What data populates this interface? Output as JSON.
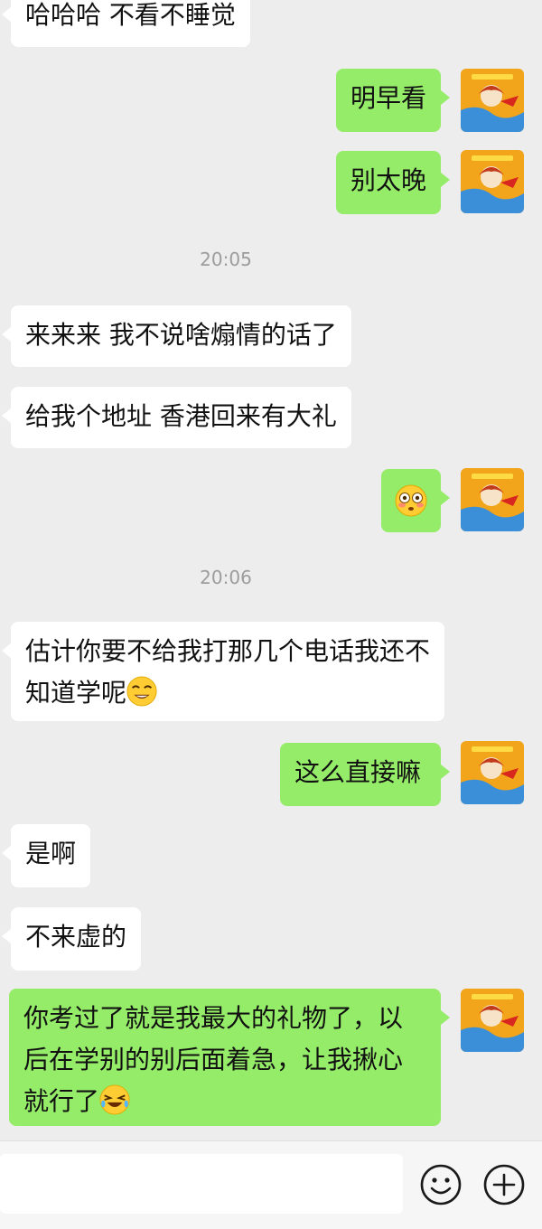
{
  "messages": [
    {
      "side": "in",
      "text": "哈哈哈 不看不睡觉"
    },
    {
      "side": "out",
      "text": "明早看"
    },
    {
      "side": "out",
      "text": "别太晚"
    },
    {
      "type": "time",
      "text": "20:05"
    },
    {
      "side": "in",
      "text": "来来来 我不说啥煽情的话了"
    },
    {
      "side": "in",
      "text": "给我个地址 香港回来有大礼"
    },
    {
      "side": "out",
      "emoji": "flushed-face-emoji"
    },
    {
      "type": "time",
      "text": "20:06"
    },
    {
      "side": "in",
      "text": "估计你要不给我打那几个电话我还不知道学呢"
    },
    {
      "side": "out",
      "text": "这么直接嘛"
    },
    {
      "side": "in",
      "text": "是啊"
    },
    {
      "side": "in",
      "text": "不来虚的"
    },
    {
      "side": "out",
      "text": "你考过了就是我最大的礼物了，以后在学别的别后面着急，让我揪心就行了"
    }
  ],
  "colors": {
    "background": "#ededed",
    "incoming_bubble": "#ffffff",
    "outgoing_bubble": "#95ec69",
    "timestamp_text": "#9c9c9c"
  },
  "icons": {
    "emoji_button": "smiley-face-icon",
    "more_button": "plus-circle-icon"
  }
}
